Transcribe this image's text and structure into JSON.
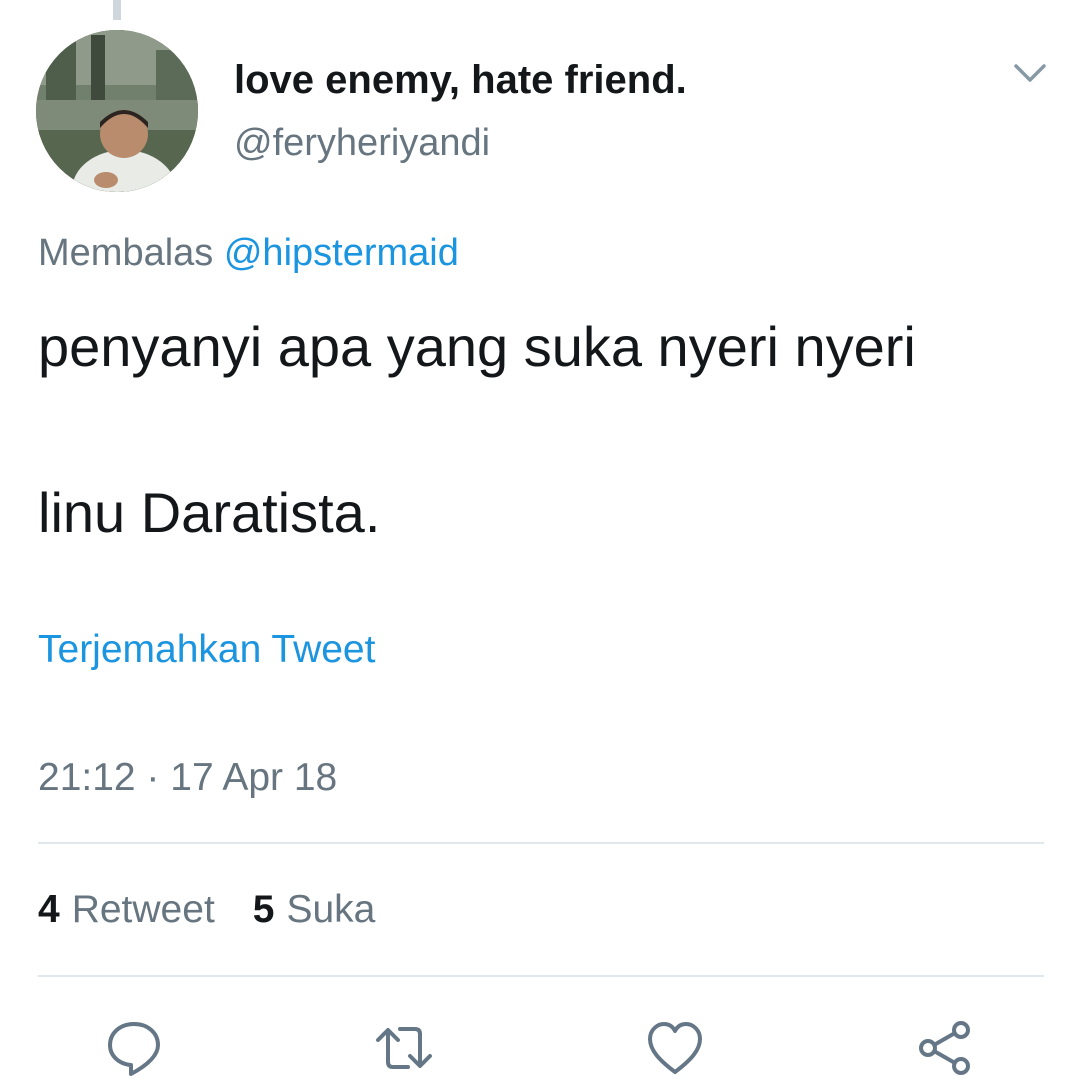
{
  "author": {
    "display_name": "love enemy, hate friend.",
    "handle": "@feryheriyandi"
  },
  "reply": {
    "prefix": "Membalas",
    "mention": "@hipstermaid"
  },
  "tweet": {
    "line1": "penyanyi apa yang suka nyeri nyeri",
    "line2": "linu Daratista."
  },
  "translate_link": "Terjemahkan Tweet",
  "timestamp": "21:12 · 17 Apr 18",
  "stats": {
    "retweets": {
      "count": "4",
      "label": "Retweet"
    },
    "likes": {
      "count": "5",
      "label": "Suka"
    }
  },
  "actions": [
    "reply-icon",
    "retweet-icon",
    "like-icon",
    "share-icon"
  ],
  "colors": {
    "link": "#1b95e0",
    "secondary_text": "#66757f",
    "primary_text": "#14171a",
    "divider": "#e1e8ed"
  }
}
